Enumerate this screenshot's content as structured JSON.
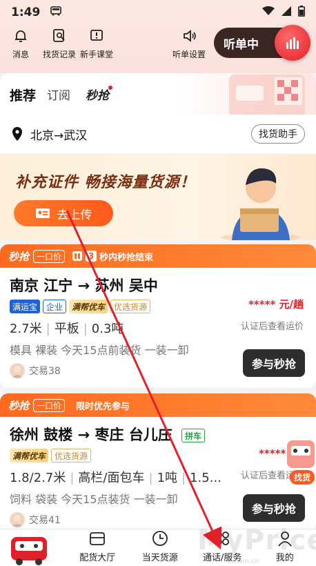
{
  "status": {
    "time": "1:49"
  },
  "toolbar": {
    "messages": "消息",
    "find_history": "找货记录",
    "beginner": "新手课堂",
    "listen_settings": "听单设置",
    "listening": "听单中"
  },
  "tabs": {
    "recommend": "推荐",
    "subscribe": "订阅",
    "grab": "秒抢"
  },
  "route": {
    "text": "北京→武汉",
    "helper": "找货助手"
  },
  "banner": {
    "headline": "补充证件 畅接海量货源！",
    "upload": "去上传"
  },
  "cards": [
    {
      "tag": "秒抢",
      "price_type": "一口价",
      "countdown_num": "3",
      "countdown_text": "秒内秒抢结束",
      "title": "南京 江宁 → 苏州 吴中",
      "badges": [
        "满运宝",
        "企业",
        "满帮优车",
        "优选货源"
      ],
      "price": "***** 元/趟",
      "price_note": "认证后查看运价",
      "spec1": "2.7米",
      "spec2": "平板",
      "spec3": "0.3吨",
      "cargo": "模具 裸装 今天15点前装货 一装一卸",
      "trades": "交易38",
      "button": "参与秒抢"
    },
    {
      "tag": "秒抢",
      "price_type": "一口价",
      "countdown_text": "限时优先参与",
      "title": "徐州 鼓楼 → 枣庄 台儿庄",
      "badges": [
        "拼车",
        "满帮优车",
        "优选货源"
      ],
      "price": "***** 元/",
      "price_note": "认证后查看运价",
      "spec1": "1.8/2.7米",
      "spec2": "高栏/面包车",
      "spec3": "1吨",
      "spec4": "1.5...",
      "cargo": "饲料 袋装 今天15点装货 一装一卸",
      "trades": "交易41",
      "button": "参与秒抢"
    }
  ],
  "float": {
    "find": "找货"
  },
  "nav": {
    "hall": "配货大厅",
    "today": "当天货源",
    "calls": "通话/服务",
    "mine": "我的"
  },
  "watermark": {
    "text": "MyPrice",
    "sub": "e.com.cn"
  },
  "colors": {
    "accent": "#e2202a",
    "orange": "#ff6a1e",
    "dark_button": "#2d2d2d"
  }
}
